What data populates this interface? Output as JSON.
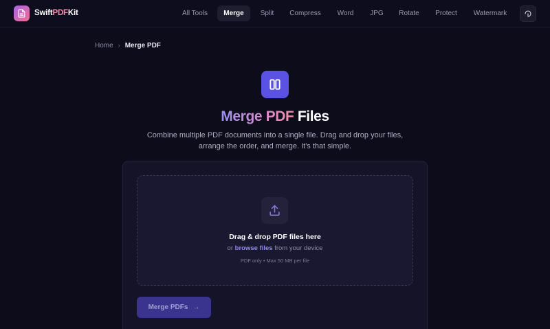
{
  "brand": {
    "part1": "Swift",
    "part2": "PDF",
    "part3": "Kit"
  },
  "nav": [
    {
      "label": "All Tools"
    },
    {
      "label": "Merge"
    },
    {
      "label": "Split"
    },
    {
      "label": "Compress"
    },
    {
      "label": "Word"
    },
    {
      "label": "JPG"
    },
    {
      "label": "Rotate"
    },
    {
      "label": "Protect"
    },
    {
      "label": "Watermark"
    }
  ],
  "active_nav": "Merge",
  "breadcrumb": {
    "home": "Home",
    "separator": "›",
    "current": "Merge PDF"
  },
  "hero": {
    "title_gradient": "Merge PDF",
    "title_plain": "Files",
    "subtitle": "Combine multiple PDF documents into a single file. Drag and drop your files, arrange the order, and merge. It's that simple."
  },
  "dropzone": {
    "title": "Drag & drop PDF files here",
    "prefix": "or",
    "link": "browse files",
    "suffix": "from your device",
    "note": "PDF only • Max 50 MB per file"
  },
  "merge_button": {
    "label": "Merge PDFs",
    "arrow": "→"
  },
  "icons": {
    "logo": "document-icon",
    "theme": "theme-toggle-icon",
    "hero": "merge-columns-icon",
    "upload": "upload-icon"
  },
  "colors": {
    "background": "#0d0c1b",
    "accent": "#5a52e3",
    "link": "#8f88f5",
    "button": "#3a348e"
  }
}
